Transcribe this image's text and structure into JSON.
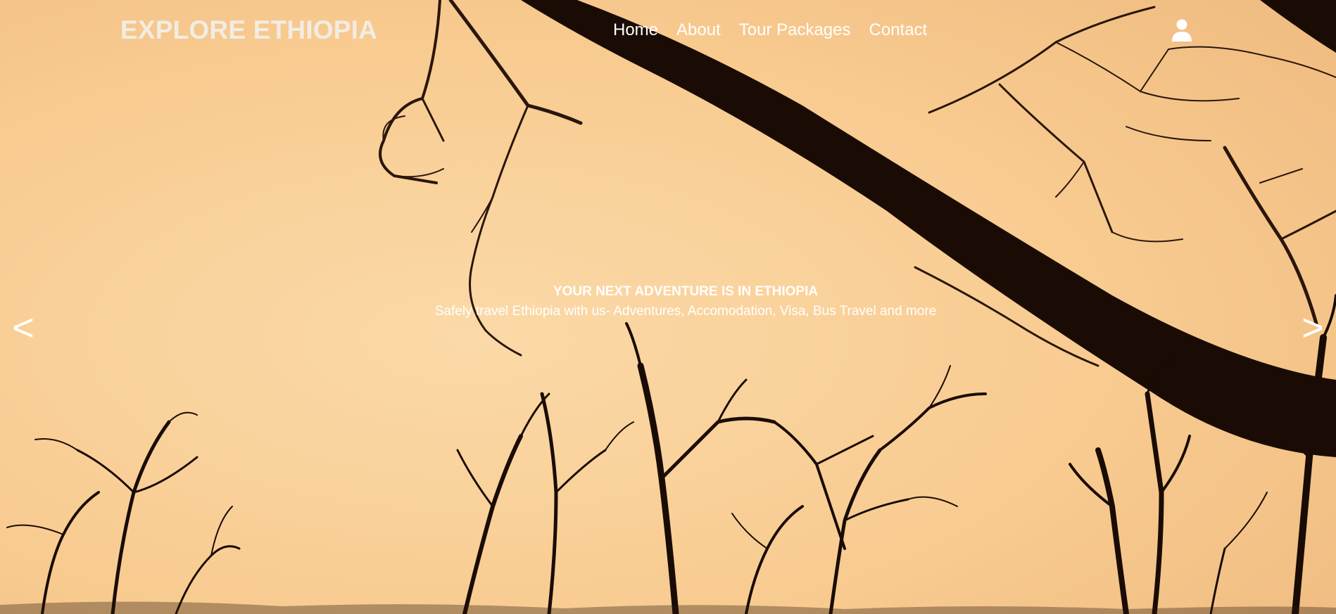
{
  "brand": {
    "name": "EXPLORE ETHIOPIA"
  },
  "nav": {
    "items": [
      {
        "label": "Home"
      },
      {
        "label": "About"
      },
      {
        "label": "Tour Packages"
      },
      {
        "label": "Contact"
      }
    ],
    "account_icon": "user-icon"
  },
  "hero": {
    "title": "YOUR NEXT ADVENTURE IS IN ETHIOPIA",
    "subtitle": "Safely travel Ethiopia with us- Adventures, Accomodation, Visa, Bus Travel and more",
    "prev_label": "<",
    "next_label": ">"
  },
  "colors": {
    "sky": "#f7c98f",
    "silhouette": "#1a0c05",
    "text": "#ffffff",
    "brand_text": "#f2ece4"
  }
}
